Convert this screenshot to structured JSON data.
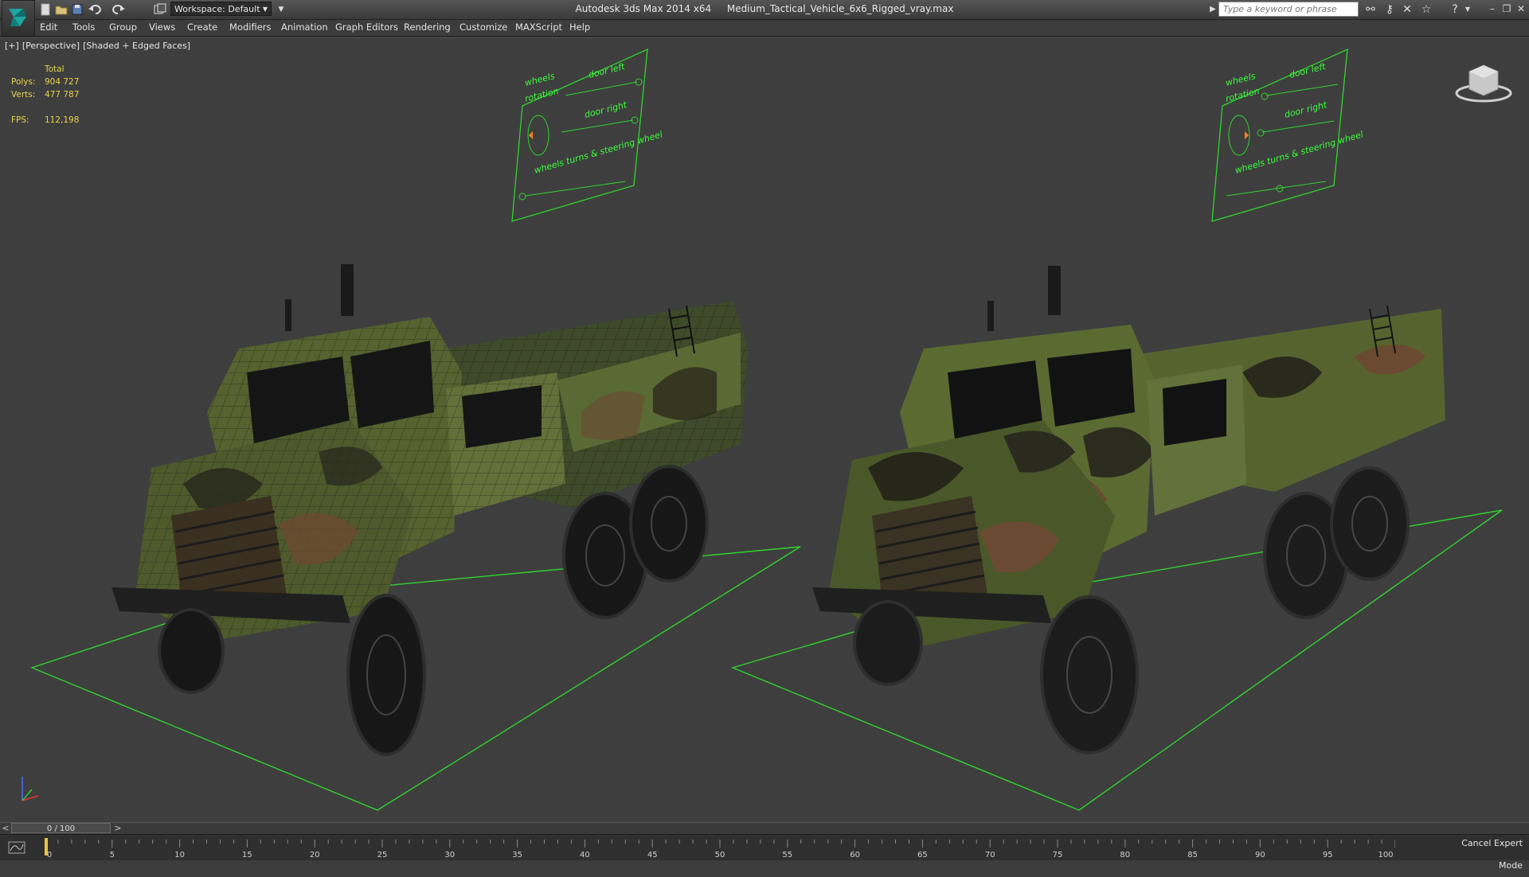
{
  "titlebar": {
    "app_title": "Autodesk 3ds Max  2014 x64",
    "file_name": "Medium_Tactical_Vehicle_6x6_Rigged_vray.max",
    "workspace_label": "Workspace: Default",
    "search_placeholder": "Type a keyword or phrase"
  },
  "menu": {
    "items": [
      "Edit",
      "Tools",
      "Group",
      "Views",
      "Create",
      "Modifiers",
      "Animation",
      "Graph Editors",
      "Rendering",
      "Customize",
      "MAXScript",
      "Help"
    ]
  },
  "viewport": {
    "label_plus": "[+]",
    "label_view": "[Perspective]",
    "label_shading": "[Shaded + Edged Faces]",
    "stats": {
      "header": "Total",
      "polys_label": "Polys:",
      "polys_value": "904 727",
      "verts_label": "Verts:",
      "verts_value": "477 787",
      "fps_label": "FPS:",
      "fps_value": "112,198"
    },
    "rig_panel": {
      "wheels_rotation": [
        "wheels",
        "rotation"
      ],
      "door_left": "door left",
      "door_right": "door right",
      "wheels_turns": "wheels turns & steering wheel"
    }
  },
  "timeline": {
    "frame_display": "0 / 100",
    "prev_arrow": "<",
    "next_arrow": ">",
    "current_frame": 0,
    "total_frames": 100,
    "ticks": [
      "0",
      "5",
      "10",
      "15",
      "20",
      "25",
      "30",
      "35",
      "40",
      "45",
      "50",
      "55",
      "60",
      "65",
      "70",
      "75",
      "80",
      "85",
      "90",
      "95",
      "100"
    ]
  },
  "status": {
    "cancel_expert_mode": "Cancel Expert Mode"
  },
  "colors": {
    "rig_green": "#3bff3b",
    "stats_yellow": "#e5d44a",
    "viewport_bg": "#3e3e3e"
  }
}
